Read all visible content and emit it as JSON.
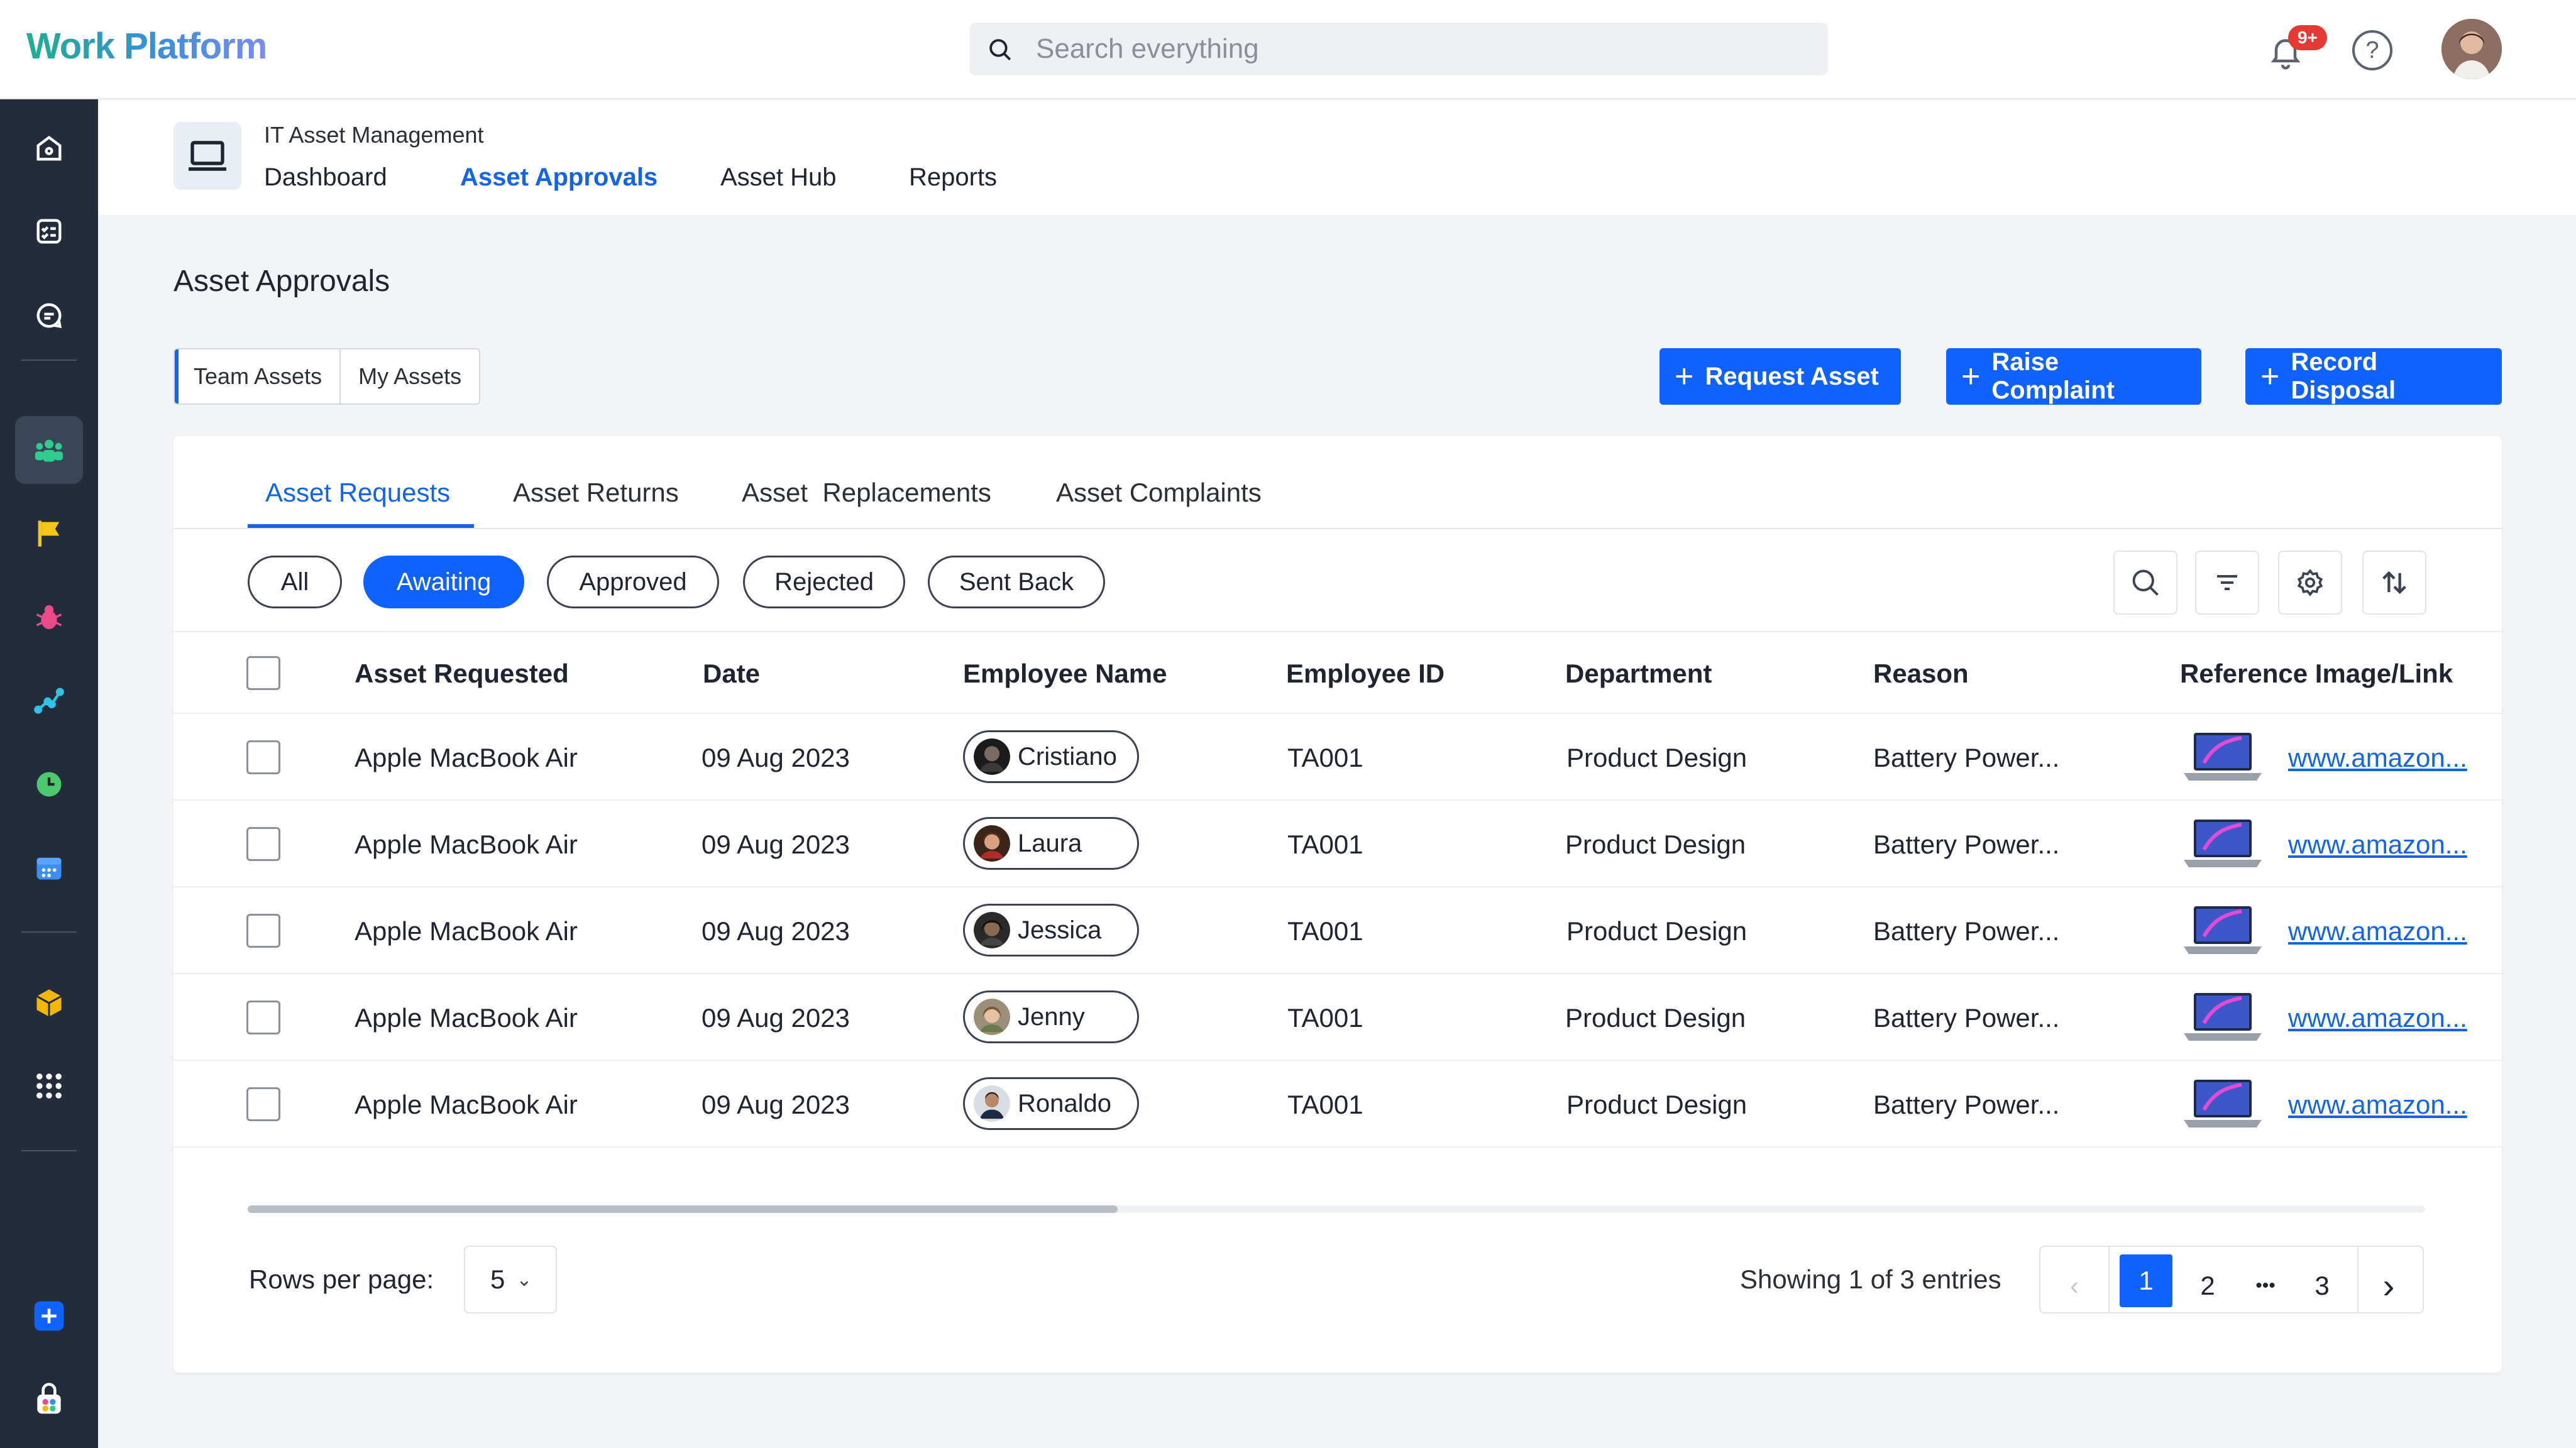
{
  "app": {
    "name": "Work Platform"
  },
  "search": {
    "placeholder": "Search everything"
  },
  "notifications": {
    "badge": "9+"
  },
  "module": {
    "name": "IT Asset Management",
    "tabs": [
      "Dashboard",
      "Asset Approvals",
      "Asset Hub",
      "Reports"
    ],
    "active_tab": "Asset Approvals"
  },
  "page": {
    "title": "Asset Approvals"
  },
  "scope_toggle": {
    "options": [
      "Team Assets",
      "My Assets"
    ],
    "selected": "Team Assets"
  },
  "actions": {
    "request_asset": "Request Asset",
    "raise_complaint": "Raise Complaint",
    "record_disposal": "Record Disposal"
  },
  "card_tabs": {
    "items": [
      "Asset Requests",
      "Asset Returns",
      "Asset  Replacements",
      "Asset Complaints"
    ],
    "active": "Asset Requests"
  },
  "filters": {
    "items": [
      "All",
      "Awaiting",
      "Approved",
      "Rejected",
      "Sent Back"
    ],
    "active": "Awaiting"
  },
  "table": {
    "columns": [
      "Asset Requested",
      "Date",
      "Employee Name",
      "Employee ID",
      "Department",
      "Reason",
      "Reference Image/Link"
    ],
    "rows": [
      {
        "asset": "Apple MacBook Air",
        "date": "09 Aug 2023",
        "employee": "Cristiano",
        "employee_id": "TA001",
        "department": "Product Design",
        "reason": "Battery Power...",
        "link": "www.amazon..."
      },
      {
        "asset": "Apple MacBook Air",
        "date": "09 Aug 2023",
        "employee": "Laura",
        "employee_id": "TA001",
        "department": "Product Design",
        "reason": "Battery Power...",
        "link": "www.amazon..."
      },
      {
        "asset": "Apple MacBook Air",
        "date": "09 Aug 2023",
        "employee": "Jessica",
        "employee_id": "TA001",
        "department": "Product Design",
        "reason": "Battery Power...",
        "link": "www.amazon..."
      },
      {
        "asset": "Apple MacBook Air",
        "date": "09 Aug 2023",
        "employee": "Jenny",
        "employee_id": "TA001",
        "department": "Product Design",
        "reason": "Battery Power...",
        "link": "www.amazon..."
      },
      {
        "asset": "Apple MacBook Air",
        "date": "09 Aug 2023",
        "employee": "Ronaldo",
        "employee_id": "TA001",
        "department": "Product Design",
        "reason": "Battery Power...",
        "link": "www.amazon..."
      }
    ]
  },
  "pagination": {
    "rows_per_page_label": "Rows per page:",
    "rows_per_page": "5",
    "showing": "Showing 1 of 3 entries",
    "pages": [
      "1",
      "2",
      "3"
    ],
    "ellipsis": "•••",
    "current": "1"
  },
  "colors": {
    "primary": "#0f62fe",
    "sidebar": "#232c3b",
    "accent_text": "#1464e6"
  }
}
